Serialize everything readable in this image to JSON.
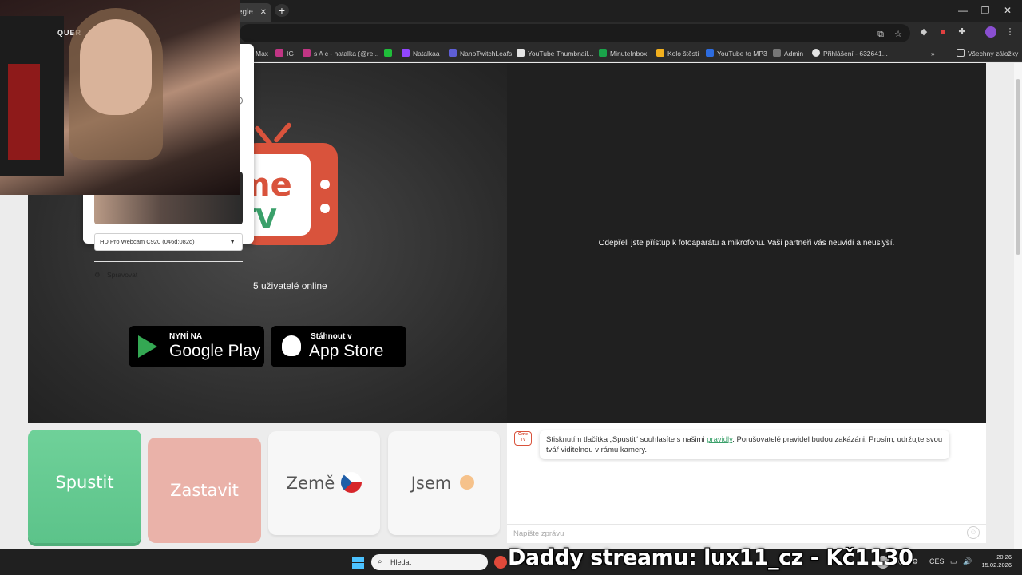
{
  "browser": {
    "tab_label": "egle",
    "tab_close": "✕",
    "new_tab": "+",
    "window_controls": [
      "—",
      "❐",
      "✕"
    ]
  },
  "bookmarks": {
    "items": [
      {
        "label": "Max",
        "color": "#d04040"
      },
      {
        "label": "IG",
        "color": "#c13584"
      },
      {
        "label": "s A c - natalka (@re...",
        "color": "#c13584"
      },
      {
        "label": "",
        "color": "#1fbf3a"
      },
      {
        "label": "Natalkaa",
        "color": "#9146ff"
      },
      {
        "label": "NanoTwitchLeafs",
        "color": "#5e5ed6"
      },
      {
        "label": "YouTube Thumbnail...",
        "color": "#e5e5e5"
      },
      {
        "label": "MinuteInbox",
        "color": "#1aa34a"
      },
      {
        "label": "Kolo štěstí",
        "color": "#f2b01e"
      },
      {
        "label": "YouTube to MP3",
        "color": "#2d6cdf"
      },
      {
        "label": "Admin",
        "color": "#777777"
      },
      {
        "label": "Přihlášení - 632641...",
        "color": "#e5e5e5"
      }
    ],
    "overflow": "»",
    "all_bookmarks": "Všechny záložky"
  },
  "hero": {
    "logo_ome": "me",
    "logo_tv": "TV",
    "online_text": "5 uživatelé online",
    "google_play": {
      "small": "NYNÍ NA",
      "big": "Google Play"
    },
    "app_store": {
      "small": "Stáhnout v",
      "big": "App Store"
    }
  },
  "partner": {
    "message": "Odepřeli jste přístup k fotoaparátu a mikrofonu. Vaši partneři vás neuvidí a neuslyší."
  },
  "camera_popup": {
    "device": "HD Pro Webcam C920 (046d:082d)",
    "manage_label": "Spravovat"
  },
  "streamer": {
    "chair_logo": "QUER"
  },
  "controls": {
    "start": "Spustit",
    "stop": "Zastavit",
    "country": "Země",
    "gender": "Jsem"
  },
  "chat": {
    "logo_top": "Ome",
    "logo_bottom": "TV",
    "notice_before": "Stisknutím tlačítka „Spustit“ souhlasíte s našimi ",
    "notice_link": "pravidly",
    "notice_after": ". Porušovatelé pravidel budou zakázáni. Prosím, udržujte svou tvář viditelnou v rámu kamery.",
    "placeholder": "Napište zprávu"
  },
  "taskbar": {
    "search_label": "Hledat",
    "overlay_text": "Daddy streamu: lux11_cz - Kč1130",
    "language": "CES",
    "time": "20:26",
    "date": "15.02.2026"
  },
  "colors": {
    "brand_red": "#d9533c",
    "brand_green": "#3aa06a",
    "start_green": "#5cc38a",
    "stop_salmon": "#eab2a9"
  }
}
